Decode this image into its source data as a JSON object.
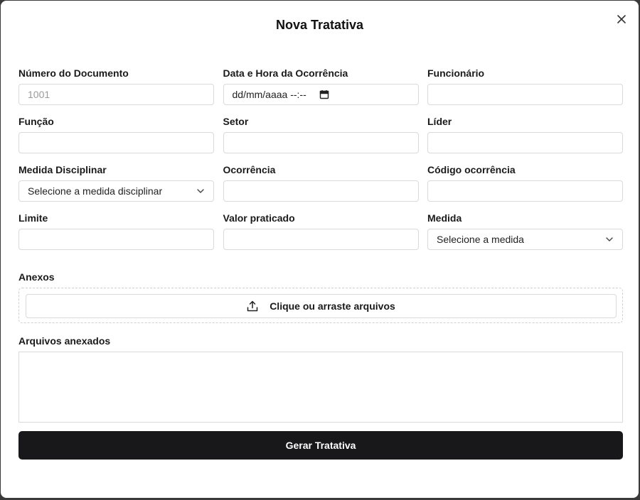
{
  "modal": {
    "title": "Nova Tratativa",
    "close_icon": "close-icon"
  },
  "fields": {
    "numero_documento": {
      "label": "Número do Documento",
      "placeholder": "1001",
      "value": ""
    },
    "data_hora": {
      "label": "Data e Hora da Ocorrência",
      "value": "dd/mm/aaaa --:--",
      "icon": "calendar-icon"
    },
    "funcionario": {
      "label": "Funcionário",
      "value": ""
    },
    "funcao": {
      "label": "Função",
      "value": ""
    },
    "setor": {
      "label": "Setor",
      "value": ""
    },
    "lider": {
      "label": "Líder",
      "value": ""
    },
    "medida_disciplinar": {
      "label": "Medida Disciplinar",
      "selected": "Selecione a medida disciplinar"
    },
    "ocorrencia": {
      "label": "Ocorrência",
      "value": ""
    },
    "codigo_ocorrencia": {
      "label": "Código ocorrência",
      "value": ""
    },
    "limite": {
      "label": "Limite",
      "value": ""
    },
    "valor_praticado": {
      "label": "Valor praticado",
      "value": ""
    },
    "medida": {
      "label": "Medida",
      "selected": "Selecione a medida"
    }
  },
  "anexos": {
    "label": "Anexos",
    "upload_label": "Clique ou arraste arquivos",
    "upload_icon": "upload-icon"
  },
  "arquivos_anexados": {
    "label": "Arquivos anexados"
  },
  "submit": {
    "label": "Gerar Tratativa"
  }
}
